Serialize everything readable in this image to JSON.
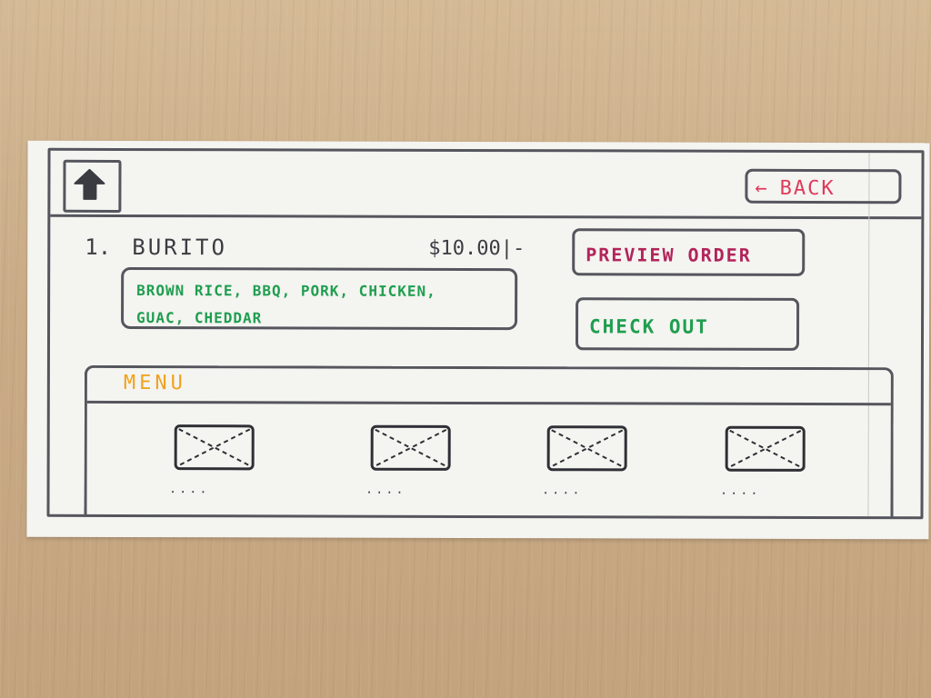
{
  "header": {
    "home_icon": "home-icon",
    "back_arrow": "←",
    "back_label": "BACK"
  },
  "order": {
    "item_number": "1.",
    "item_name": "BURITO",
    "price": "$10.00|-",
    "ingredients_line1": "BROWN RICE, BBQ, PORK, CHICKEN,",
    "ingredients_line2": "GUAC, CHEDDAR"
  },
  "actions": {
    "preview_label": "PREVIEW ORDER",
    "checkout_label": "CHECK OUT"
  },
  "menu": {
    "title": "MENU",
    "items": [
      {
        "placeholder": "image-placeholder",
        "dots": "...."
      },
      {
        "placeholder": "image-placeholder",
        "dots": "...."
      },
      {
        "placeholder": "image-placeholder",
        "dots": "...."
      },
      {
        "placeholder": "image-placeholder",
        "dots": "...."
      }
    ]
  },
  "colors": {
    "back": "#e0395a",
    "preview": "#b3245a",
    "checkout": "#1f9e4f",
    "ingredients": "#1f9e4f",
    "menu_title": "#f0a21b",
    "ink": "#55565d"
  }
}
